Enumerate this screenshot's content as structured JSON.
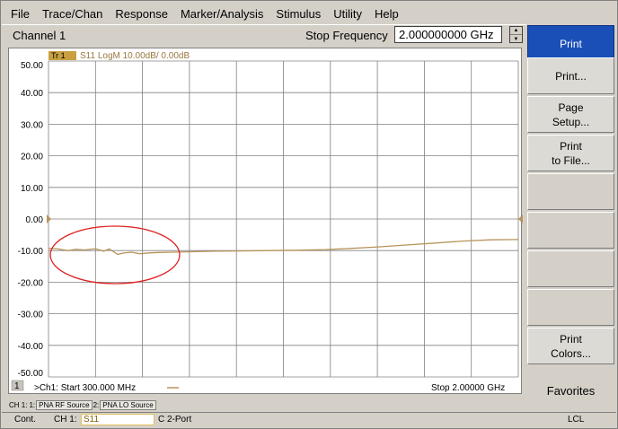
{
  "menu": [
    "File",
    "Trace/Chan",
    "Response",
    "Marker/Analysis",
    "Stimulus",
    "Utility",
    "Help"
  ],
  "toolbar": {
    "channel": "Channel 1",
    "stop_label": "Stop Frequency",
    "stop_value": "2.000000000 GHz"
  },
  "trace_header": {
    "tr_badge": "Tr  1",
    "description": "S11 LogM 10.00dB/  0.00dB"
  },
  "footer": {
    "ch_number": "1",
    "start": ">Ch1: Start  300.000 MHz",
    "stop": "Stop  2.00000 GHz"
  },
  "softkeys": [
    {
      "lines": [
        "Print"
      ],
      "active": true
    },
    {
      "lines": [
        "Print..."
      ]
    },
    {
      "lines": [
        "Page",
        "Setup..."
      ]
    },
    {
      "lines": [
        "Print",
        "to File..."
      ]
    },
    {
      "lines": []
    },
    {
      "lines": []
    },
    {
      "lines": []
    },
    {
      "lines": []
    },
    {
      "lines": [
        "Print",
        "Colors..."
      ]
    }
  ],
  "favorites": "Favorites",
  "source_bar": {
    "ch": "CH 1:",
    "src1_num": "1:",
    "src1": "PNA RF Source",
    "src2_num": "2:",
    "src2": "PNA LO Source"
  },
  "status": {
    "mode": "Cont.",
    "channel": "CH 1:",
    "measurement": "S11",
    "port": "C  2-Port",
    "remote": "LCL"
  },
  "colors": {
    "trace": "#b8945a",
    "badge": "#c8a040",
    "annotation_ellipse": "#e02020",
    "active_softkey": "#1a4fb8"
  },
  "chart_data": {
    "type": "line",
    "title": "S11 LogM 10.00dB/  0.00dB",
    "xlabel": "",
    "ylabel": "",
    "x_unit": "GHz",
    "xlim": [
      0.3,
      2.0
    ],
    "ylim": [
      -50,
      50
    ],
    "y_ticks": [
      "50.00",
      "40.00",
      "30.00",
      "20.00",
      "10.00",
      "0.00",
      "-10.00",
      "-20.00",
      "-30.00",
      "-40.00",
      "-50.00"
    ],
    "y_tick_values": [
      50,
      40,
      30,
      20,
      10,
      0,
      -10,
      -20,
      -30,
      -40,
      -50
    ],
    "x_divisions": 10,
    "grid": true,
    "reference_level": 0.0,
    "series": [
      {
        "name": "S11",
        "x": [
          0.3,
          0.33,
          0.37,
          0.4,
          0.43,
          0.47,
          0.5,
          0.52,
          0.55,
          0.57,
          0.6,
          0.63,
          0.67,
          0.7,
          0.75,
          0.8,
          0.9,
          1.0,
          1.1,
          1.2,
          1.3,
          1.4,
          1.5,
          1.6,
          1.7,
          1.8,
          1.9,
          2.0
        ],
        "y": [
          -9.3,
          -9.4,
          -10.0,
          -9.6,
          -9.8,
          -9.4,
          -10.2,
          -9.5,
          -11.2,
          -10.8,
          -10.5,
          -11.0,
          -10.7,
          -10.6,
          -10.5,
          -10.4,
          -10.2,
          -10.1,
          -10.0,
          -9.9,
          -9.7,
          -9.3,
          -8.8,
          -8.2,
          -7.6,
          -7.0,
          -6.6,
          -6.5
        ]
      }
    ],
    "annotation": "ellipse around 0.30–0.70 GHz"
  }
}
